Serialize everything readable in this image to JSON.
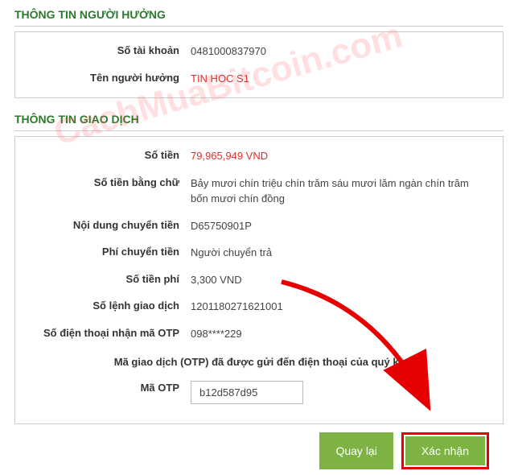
{
  "watermark": "CachMuaBitcoin.com",
  "beneficiary": {
    "title": "THÔNG TIN NGƯỜI HƯỞNG",
    "account_label": "Số tài khoản",
    "account_value": "0481000837970",
    "name_label": "Tên người hưởng",
    "name_value": "TIN HOC S1"
  },
  "transaction": {
    "title": "THÔNG TIN GIAO DỊCH",
    "amount_label": "Số tiền",
    "amount_value": "79,965,949 VND",
    "amount_words_label": "Số tiền bằng chữ",
    "amount_words_value": "Bảy mươi chín triệu chín trăm sáu mươi lăm ngàn chín trăm bốn mươi chín đồng",
    "content_label": "Nội dung chuyển tiền",
    "content_value": "D65750901P",
    "fee_by_label": "Phí chuyển tiền",
    "fee_by_value": "Người chuyển trả",
    "fee_amount_label": "Số tiền phí",
    "fee_amount_value": "3,300 VND",
    "order_label": "Số lệnh giao dịch",
    "order_value": "1201180271621001",
    "phone_label": "Số điện thoại nhận mã OTP",
    "phone_value": "098****229",
    "notice": "Mã giao dịch (OTP) đã được gửi đến điện thoại của quý khách!",
    "otp_label": "Mã OTP",
    "otp_value": "b12d587d95"
  },
  "buttons": {
    "back": "Quay lại",
    "confirm": "Xác nhận"
  }
}
